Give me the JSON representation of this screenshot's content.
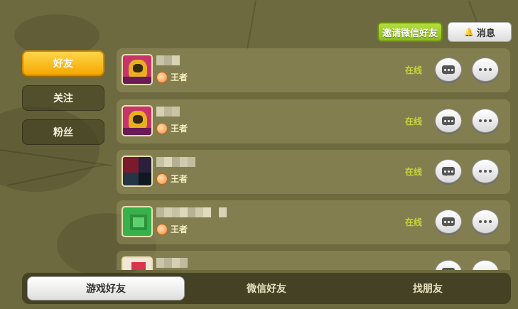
{
  "header": {
    "invite_label": "邀请微信好友",
    "message_label": "消息",
    "message_icon": "bell-icon"
  },
  "side_tabs": [
    {
      "label": "好友",
      "active": true
    },
    {
      "label": "关注",
      "active": false
    },
    {
      "label": "粉丝",
      "active": false
    }
  ],
  "friends": [
    {
      "rank": "王者",
      "status": "在线",
      "avatar": "golden-character-avatar"
    },
    {
      "rank": "王者",
      "status": "在线",
      "avatar": "golden-character-avatar"
    },
    {
      "rank": "王者",
      "status": "在线",
      "avatar": "dark-pixelated-avatar"
    },
    {
      "rank": "王者",
      "status": "在线",
      "avatar": "green-pixelated-avatar"
    },
    {
      "rank": "",
      "status": "",
      "avatar": "pink-pixelated-avatar"
    }
  ],
  "bottom_tabs": [
    {
      "label": "游戏好友",
      "active": true
    },
    {
      "label": "微信好友",
      "active": false
    },
    {
      "label": "找朋友",
      "active": false
    }
  ],
  "colors": {
    "background": "#6e6a3f",
    "active_tab": "#f5a800",
    "invite_button": "#8fbd1e",
    "online_status": "#c7d63a"
  }
}
